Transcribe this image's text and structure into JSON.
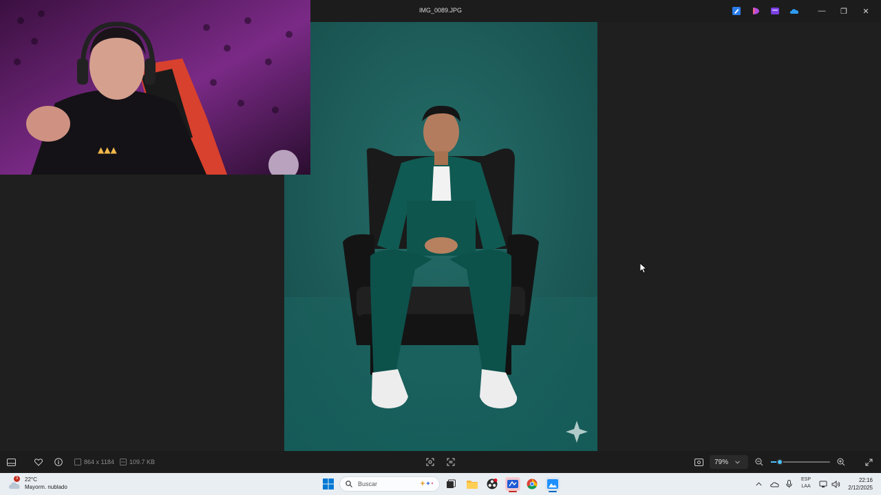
{
  "window": {
    "title": "IMG_0089.JPG",
    "controls": {
      "minimize": "—",
      "restore": "❐",
      "close": "✕"
    }
  },
  "title_icons": [
    "edit-app-icon",
    "designer-icon",
    "clipchamp-icon",
    "onedrive-icon"
  ],
  "image_info": {
    "dimensions": "864 x 1184",
    "file_size": "109.7 KB"
  },
  "zoom": {
    "value": "79%",
    "level": 0.15
  },
  "taskbar": {
    "weather_badge": "3",
    "temperature": "22°C",
    "condition": "Mayorm. nublado",
    "search_placeholder": "Buscar",
    "lang_top": "ESP",
    "lang_bottom": "LAA",
    "time": "22:16",
    "date": "2/12/2025"
  },
  "colors": {
    "backdrop": "#1b5c58",
    "accent": "#4cc2ff"
  }
}
